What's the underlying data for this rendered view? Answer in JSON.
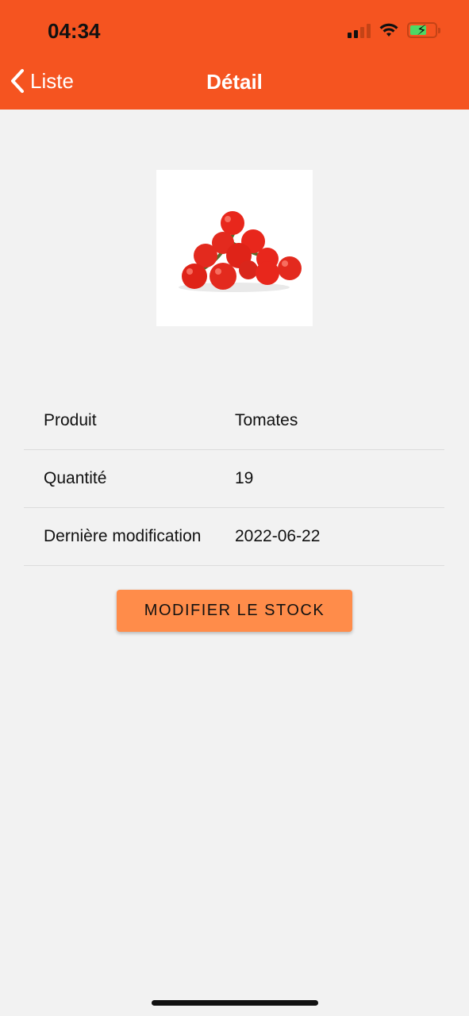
{
  "status_bar": {
    "time": "04:34",
    "icons": [
      "signal-icon",
      "wifi-icon",
      "battery-charging-icon"
    ]
  },
  "nav": {
    "back_label": "Liste",
    "title": "Détail"
  },
  "product": {
    "image": "tomatoes-image",
    "rows": [
      {
        "label": "Produit",
        "value": "Tomates"
      },
      {
        "label": "Quantité",
        "value": "19"
      },
      {
        "label": "Dernière modification",
        "value": "2022-06-22"
      }
    ]
  },
  "actions": {
    "modify_stock_label": "MODIFIER LE STOCK"
  },
  "colors": {
    "header": "#f55420",
    "button": "#ff8c4a",
    "background": "#f2f2f2"
  }
}
